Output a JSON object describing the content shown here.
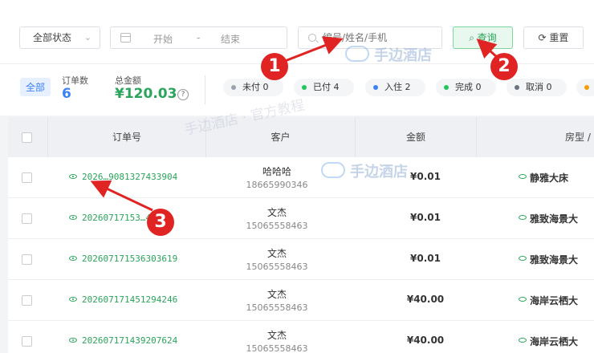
{
  "filters": {
    "status_select": "全部状态",
    "date_start": "开始",
    "date_sep": "-",
    "date_end": "结束",
    "search_placeholder": "编号/姓名/手机",
    "query_button": "查询",
    "reset_button": "重置"
  },
  "summary": {
    "all_tag": "全部",
    "order_count_label": "订单数",
    "order_count": "6",
    "total_amount_label": "总金额",
    "total_amount": "¥120.03",
    "help": "?",
    "statuses": [
      {
        "label": "未付 0",
        "color": "#9ca3af"
      },
      {
        "label": "已付 4",
        "color": "#22c55e"
      },
      {
        "label": "入住 2",
        "color": "#3b82f6"
      },
      {
        "label": "完成 0",
        "color": "#22c55e"
      },
      {
        "label": "取消 0",
        "color": "#6b7280"
      }
    ]
  },
  "table": {
    "headers": [
      "订单号",
      "客户",
      "金额",
      "房型 /"
    ],
    "rows": [
      {
        "order_no": "2026…9081327433904",
        "name": "哈哈哈",
        "phone": "18665990346",
        "amount": "¥0.01",
        "room": "静雅大床"
      },
      {
        "order_no": "20260717153…4",
        "name": "文杰",
        "phone": "15065558463",
        "amount": "¥0.01",
        "room": "雅致海景大"
      },
      {
        "order_no": "20260717153630361​9",
        "name": "文杰",
        "phone": "15065558463",
        "amount": "¥0.01",
        "room": "雅致海景大"
      },
      {
        "order_no": "20260717145129424​6",
        "name": "文杰",
        "phone": "15065558463",
        "amount": "¥40.00",
        "room": "海岸云栖大"
      },
      {
        "order_no": "20260717143920762​4",
        "name": "文杰",
        "phone": "15065558463",
        "amount": "¥40.00",
        "room": "海岸云栖大"
      }
    ]
  },
  "watermarks": {
    "logo_text": "手边酒店",
    "tutorial": "手边酒店 · 官方教程"
  },
  "callouts": [
    "1",
    "2",
    "3"
  ],
  "colors": {
    "accent_green": "#2ba45b",
    "accent_blue": "#3b82f6",
    "callout_red": "#e02424"
  }
}
